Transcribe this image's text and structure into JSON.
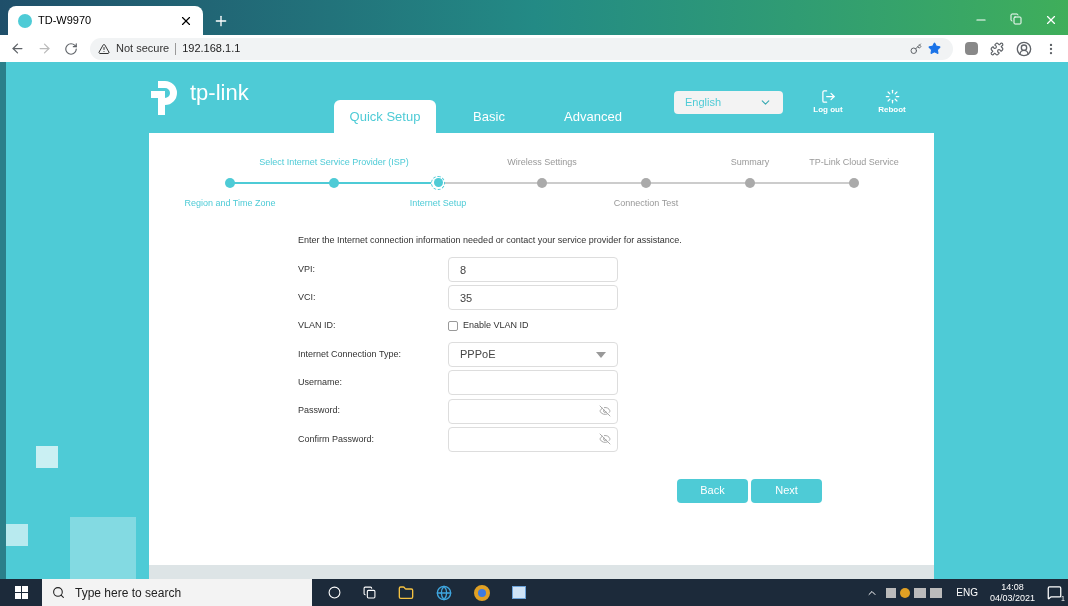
{
  "browser": {
    "tab_title": "TD-W9970",
    "security": "Not secure",
    "url": "192.168.1.1"
  },
  "nav": {
    "tabs": [
      {
        "label": "Quick Setup",
        "selected": true
      },
      {
        "label": "Basic",
        "selected": false
      },
      {
        "label": "Advanced",
        "selected": false
      }
    ],
    "language": "English",
    "actions": [
      {
        "kind": "logout",
        "label": "Log out"
      },
      {
        "kind": "reboot",
        "label": "Reboot"
      }
    ]
  },
  "logo": "tp-link",
  "steps": [
    {
      "label": "Region and Time Zone",
      "label_above": false,
      "done": true,
      "current": false
    },
    {
      "label": "Select Internet Service Provider (ISP)",
      "label_above": true,
      "done": true,
      "current": false
    },
    {
      "label": "Internet Setup",
      "label_above": false,
      "done": false,
      "current": true
    },
    {
      "label": "Wireless Settings",
      "label_above": true,
      "done": false,
      "current": false
    },
    {
      "label": "Connection Test",
      "label_above": false,
      "done": false,
      "current": false
    },
    {
      "label": "Summary",
      "label_above": true,
      "done": false,
      "current": false
    },
    {
      "label": "TP-Link Cloud Service",
      "label_above": true,
      "done": false,
      "current": false
    }
  ],
  "instruction": "Enter the Internet connection information needed or contact your service provider for assistance.",
  "form": [
    {
      "kind": "text",
      "label": "VPI:",
      "value": "8"
    },
    {
      "kind": "text",
      "label": "VCI:",
      "value": "35"
    },
    {
      "kind": "checkbox",
      "label": "VLAN ID:",
      "option": "Enable VLAN ID",
      "checked": false
    },
    {
      "kind": "select",
      "label": "Internet Connection Type:",
      "value": "PPPoE"
    },
    {
      "kind": "text",
      "label": "Username:"
    },
    {
      "kind": "password",
      "label": "Password:"
    },
    {
      "kind": "password",
      "label": "Confirm Password:"
    }
  ],
  "buttons": [
    "Back",
    "Next"
  ],
  "taskbar": {
    "search": "Type here to search",
    "language": "ENG",
    "time": "14:08",
    "date": "04/03/2021",
    "notifications": "1"
  }
}
